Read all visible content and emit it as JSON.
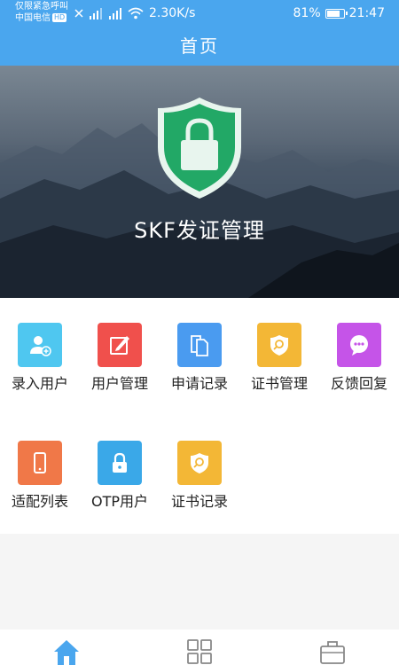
{
  "status_bar": {
    "carrier_line1": "仅限紧急呼叫",
    "carrier_line2": "中国电信",
    "hd_badge": "HD",
    "net_speed": "2.30K/s",
    "battery": "81%",
    "battery_level": 0.81,
    "time": "21:47"
  },
  "header": {
    "title": "首页"
  },
  "banner": {
    "title": "SKF发证管理",
    "icon": "shield-lock-icon"
  },
  "menu": [
    {
      "label": "录入用户",
      "icon": "add-user-icon",
      "color": "#4fc7f0"
    },
    {
      "label": "用户管理",
      "icon": "edit-icon",
      "color": "#f0504c"
    },
    {
      "label": "申请记录",
      "icon": "documents-icon",
      "color": "#4a9bf0"
    },
    {
      "label": "证书管理",
      "icon": "certificate-icon",
      "color": "#f3b736"
    },
    {
      "label": "反馈回复",
      "icon": "chat-icon",
      "color": "#c554e8"
    },
    {
      "label": "适配列表",
      "icon": "phone-icon",
      "color": "#f07848"
    },
    {
      "label": "OTP用户",
      "icon": "lock-icon",
      "color": "#3aa8e8"
    },
    {
      "label": "证书记录",
      "icon": "certificate-icon",
      "color": "#f3b736"
    }
  ],
  "tabbar": {
    "active_color": "#4aa6ee",
    "tabs": [
      {
        "icon": "home-icon"
      },
      {
        "icon": "grid-icon"
      },
      {
        "icon": "briefcase-icon"
      }
    ]
  }
}
